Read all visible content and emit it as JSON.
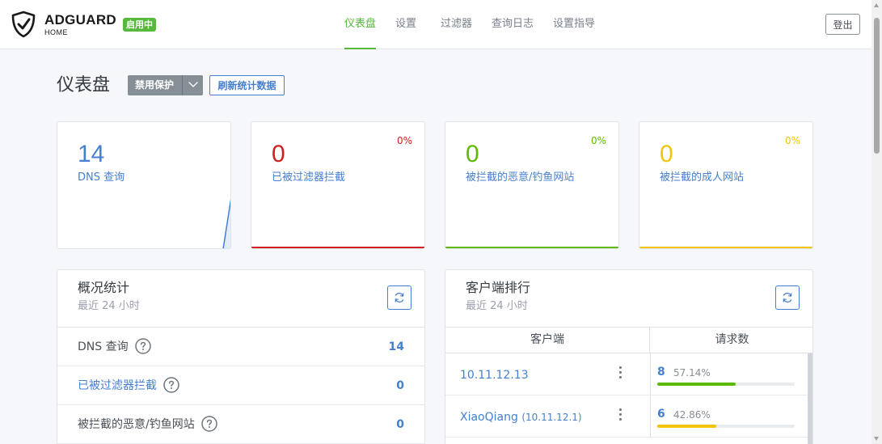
{
  "app": {
    "brand_name": "ADGUARD",
    "brand_sub": "HOME",
    "status_badge": "启用中",
    "colors": {
      "green": "#56b93b",
      "blue": "#467fcf",
      "red": "#cd201f",
      "yellow": "#f1c40f",
      "gray": "#868e96"
    }
  },
  "nav": {
    "items": [
      {
        "label": "仪表盘",
        "active": true
      },
      {
        "label": "设置",
        "active": false
      },
      {
        "label": "过滤器",
        "active": false
      },
      {
        "label": "查询日志",
        "active": false
      },
      {
        "label": "设置指导",
        "active": false
      }
    ],
    "logout_label": "登出"
  },
  "page": {
    "title": "仪表盘",
    "disable_protection_label": "禁用保护",
    "refresh_stats_label": "刷新统计数据"
  },
  "stat_cards": [
    {
      "value": "14",
      "label": "DNS 查询",
      "percent": "",
      "color": "#467fcf"
    },
    {
      "value": "0",
      "label": "已被过滤器拦截",
      "percent": "0%",
      "color": "#cd201f"
    },
    {
      "value": "0",
      "label": "被拦截的恶意/钓鱼网站",
      "percent": "0%",
      "color": "#5eba00"
    },
    {
      "value": "0",
      "label": "被拦截的成人网站",
      "percent": "0%",
      "color": "#f1c40f"
    }
  ],
  "overview": {
    "title": "概况统计",
    "subtitle": "最近 24 小时",
    "rows": [
      {
        "label": "DNS 查询",
        "value": "14"
      },
      {
        "label": "已被过滤器拦截",
        "value": "0"
      },
      {
        "label": "被拦截的恶意/钓鱼网站",
        "value": "0"
      }
    ]
  },
  "clients": {
    "title": "客户端排行",
    "subtitle": "最近 24 小时",
    "col_client": "客户端",
    "col_requests": "请求数",
    "rows": [
      {
        "name": "10.11.12.13",
        "ip": "",
        "count": "8",
        "percent": "57.14%",
        "fraction": 0.5714,
        "bar_color": "#5eba00"
      },
      {
        "name": "XiaoQiang",
        "ip": "(10.11.12.1)",
        "count": "6",
        "percent": "42.86%",
        "fraction": 0.4286,
        "bar_color": "#f1c40f"
      }
    ]
  }
}
